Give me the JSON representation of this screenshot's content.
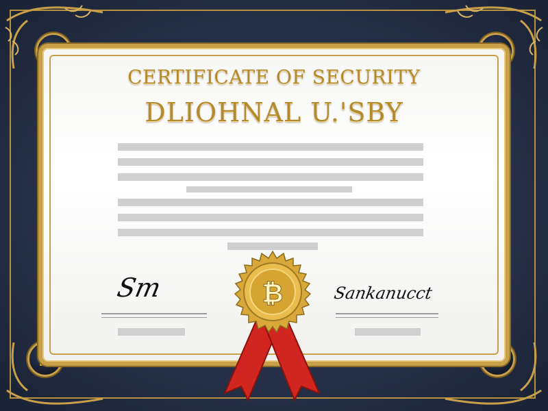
{
  "certificate": {
    "title": "CERTIFICATE OF SECURITY",
    "recipient_name": "DLIOHNAL U.'SBY",
    "seal_symbol": "₿"
  },
  "signatures": {
    "left": "Sm",
    "right": "Sankanucct"
  },
  "colors": {
    "gold": "#c9a04a",
    "navy": "#27314a",
    "ribbon": "#d1261f",
    "placeholder_gray": "#cfcfcf"
  },
  "icons": [
    "bitcoin-seal-icon",
    "corner-emblem-icon",
    "ribbon-icon",
    "flourish-icon"
  ]
}
